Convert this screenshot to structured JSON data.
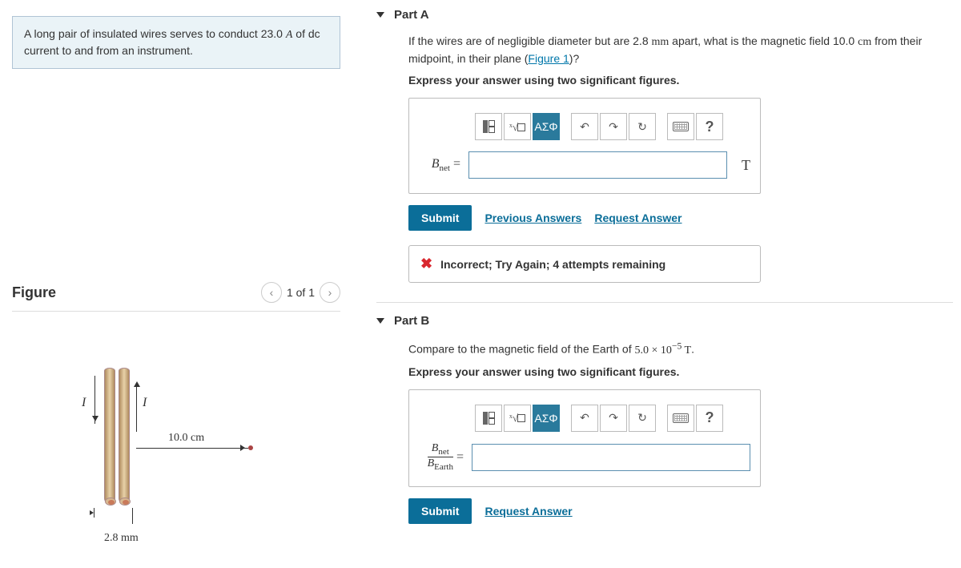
{
  "problem": {
    "text_before_current": "A long pair of insulated wires serves to conduct 23.0 ",
    "current_unit": "A",
    "text_after_current": " of dc current to and from an instrument."
  },
  "figure": {
    "title": "Figure",
    "nav": "1 of 1",
    "I_label": "I",
    "distance": "10.0 cm",
    "separation": "2.8 mm"
  },
  "partA": {
    "title": "Part A",
    "q1": "If the wires are of negligible diameter but are 2.8 ",
    "mm": "mm",
    "q2": " apart, what is the magnetic field 10.0 ",
    "cm": "cm",
    "q3": " from their midpoint, in their plane (",
    "figlink": "Figure 1",
    "q4": ")?",
    "instr": "Express your answer using two significant figures.",
    "var": "B",
    "sub": "net",
    "eq": " = ",
    "unit": "T",
    "submit": "Submit",
    "prev": "Previous Answers",
    "req": "Request Answer",
    "feedback": "Incorrect; Try Again; 4 attempts remaining",
    "greek": "ΑΣΦ"
  },
  "partB": {
    "title": "Part B",
    "q1": "Compare to the magnetic field of the Earth of ",
    "val": "5.0 × 10",
    "exp": "−5",
    "unit_T": " T",
    "q2": ".",
    "instr": "Express your answer using two significant figures.",
    "num_var": "B",
    "num_sub": "net",
    "den_var": "B",
    "den_sub": "Earth",
    "eq": " = ",
    "submit": "Submit",
    "req": "Request Answer",
    "greek": "ΑΣΦ"
  },
  "tooltips": {
    "templates": "templates",
    "sqrt": "sqrt",
    "undo": "↶",
    "redo": "↷",
    "reset": "↻",
    "keyboard": "keyboard",
    "help": "?"
  }
}
